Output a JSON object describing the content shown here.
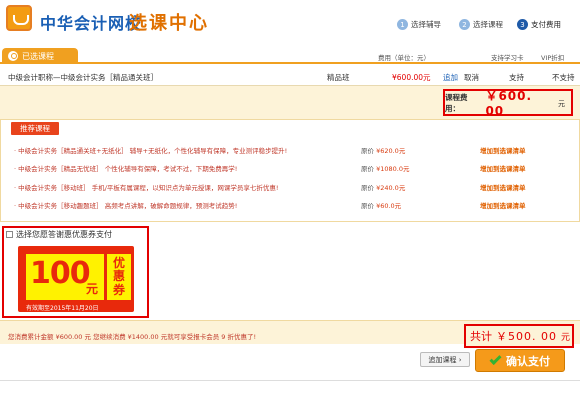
{
  "header": {
    "brand": "中华会计网校",
    "subtitle": "选课中心",
    "steps": [
      {
        "num": "1",
        "label": "选择辅导"
      },
      {
        "num": "2",
        "label": "选择课程"
      },
      {
        "num": "3",
        "label": "支付费用"
      }
    ]
  },
  "tabs": {
    "selected_label": "已选课程",
    "col_fee": "费用（单位：元）",
    "col_card": "支持学习卡",
    "col_vip": "VIP折扣"
  },
  "course": {
    "name": "中级会计职称—中级会计实务［精品通关班］",
    "type": "精品班",
    "price": "¥600.00元",
    "add": "追加",
    "cancel": "取消",
    "card": "支持",
    "vip": "不支持"
  },
  "fee": {
    "label": "课程费用：",
    "value": "￥600. 00",
    "unit": "元"
  },
  "recommend": {
    "button": "推荐课程",
    "items": [
      {
        "name": "中级会计实务［精品通关班+无纸化］",
        "desc": "辅导+无纸化，个性化辅导有保障，专业测评稳步提升!",
        "price_label": "原价",
        "price": "¥620.0元",
        "action": "增加到选课清单"
      },
      {
        "name": "中级会计实务［精品无忧班］",
        "desc": "个性化辅导有保障，考试不过，下期免费再学!",
        "price_label": "原价",
        "price": "¥1080.0元",
        "action": "增加到选课清单"
      },
      {
        "name": "中级会计实务［移动班］",
        "desc": "手机/平板有属课程，以知识点为单元授课，网课学员享七折优惠!",
        "price_label": "原价",
        "price": "¥240.0元",
        "action": "增加到选课清单"
      },
      {
        "name": "中级会计实务［移动趣题班］",
        "desc": "高频考点讲解，破解命题规律，预测考试趋势!",
        "price_label": "原价",
        "price": "¥60.0元",
        "action": "增加到选课清单"
      }
    ]
  },
  "coupon": {
    "title": "选择您愿答谢惠优惠券支付",
    "amount": "100",
    "yuan": "元",
    "side1": "优",
    "side2": "惠",
    "side3": "券",
    "expiry": "有效期至2015年11月20日"
  },
  "summary": {
    "message": "您消费累计金额 ¥600.00 元 您继续消费 ¥1400.00 元就可享受报卡会员 9 折优惠了!",
    "total_label": "共计",
    "total_value": "￥500. 00",
    "total_unit": "元"
  },
  "actions": {
    "add_list": "追加课程 ›",
    "pay": "确认支付"
  },
  "colors": {
    "brand_blue": "#1a5fb4",
    "accent_orange": "#f0a020",
    "alert_red": "#e30000"
  }
}
